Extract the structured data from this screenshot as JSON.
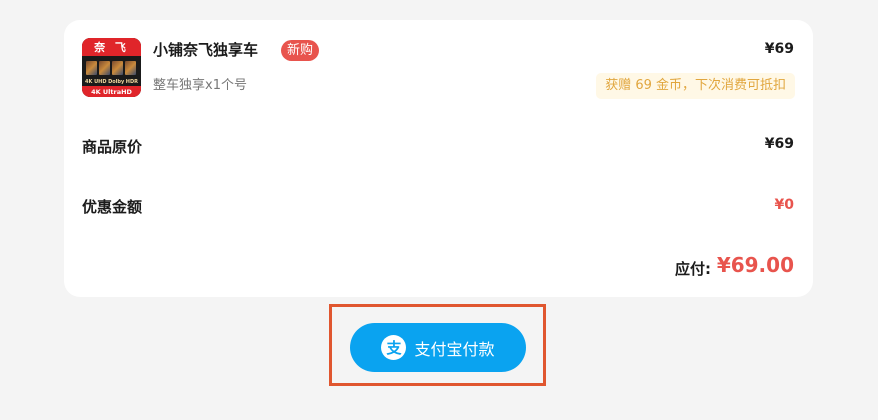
{
  "product": {
    "thumb_brand": "奈 飞",
    "thumb_tags": [
      "4K UHD",
      "Dolby",
      "HDR"
    ],
    "thumb_footer": "4K UltraHD",
    "title": "小铺奈飞独享车",
    "badge": "新购",
    "subtitle": "整车独享x1个号",
    "price": "¥69",
    "coin_tip": "获赠 69 金币，下次消费可抵扣"
  },
  "summary": {
    "original_price_label": "商品原价",
    "original_price_value": "¥69",
    "discount_label": "优惠金额",
    "discount_value": "¥0",
    "payable_label": "应付:",
    "payable_value": "¥69.00"
  },
  "payment": {
    "icon_glyph": "支",
    "button_label": "支付宝付款"
  },
  "colors": {
    "accent_red": "#e8544d",
    "alipay_blue": "#0aa3f0",
    "highlight_border": "#e0562f",
    "coin_tip_text": "#e1a63e"
  }
}
